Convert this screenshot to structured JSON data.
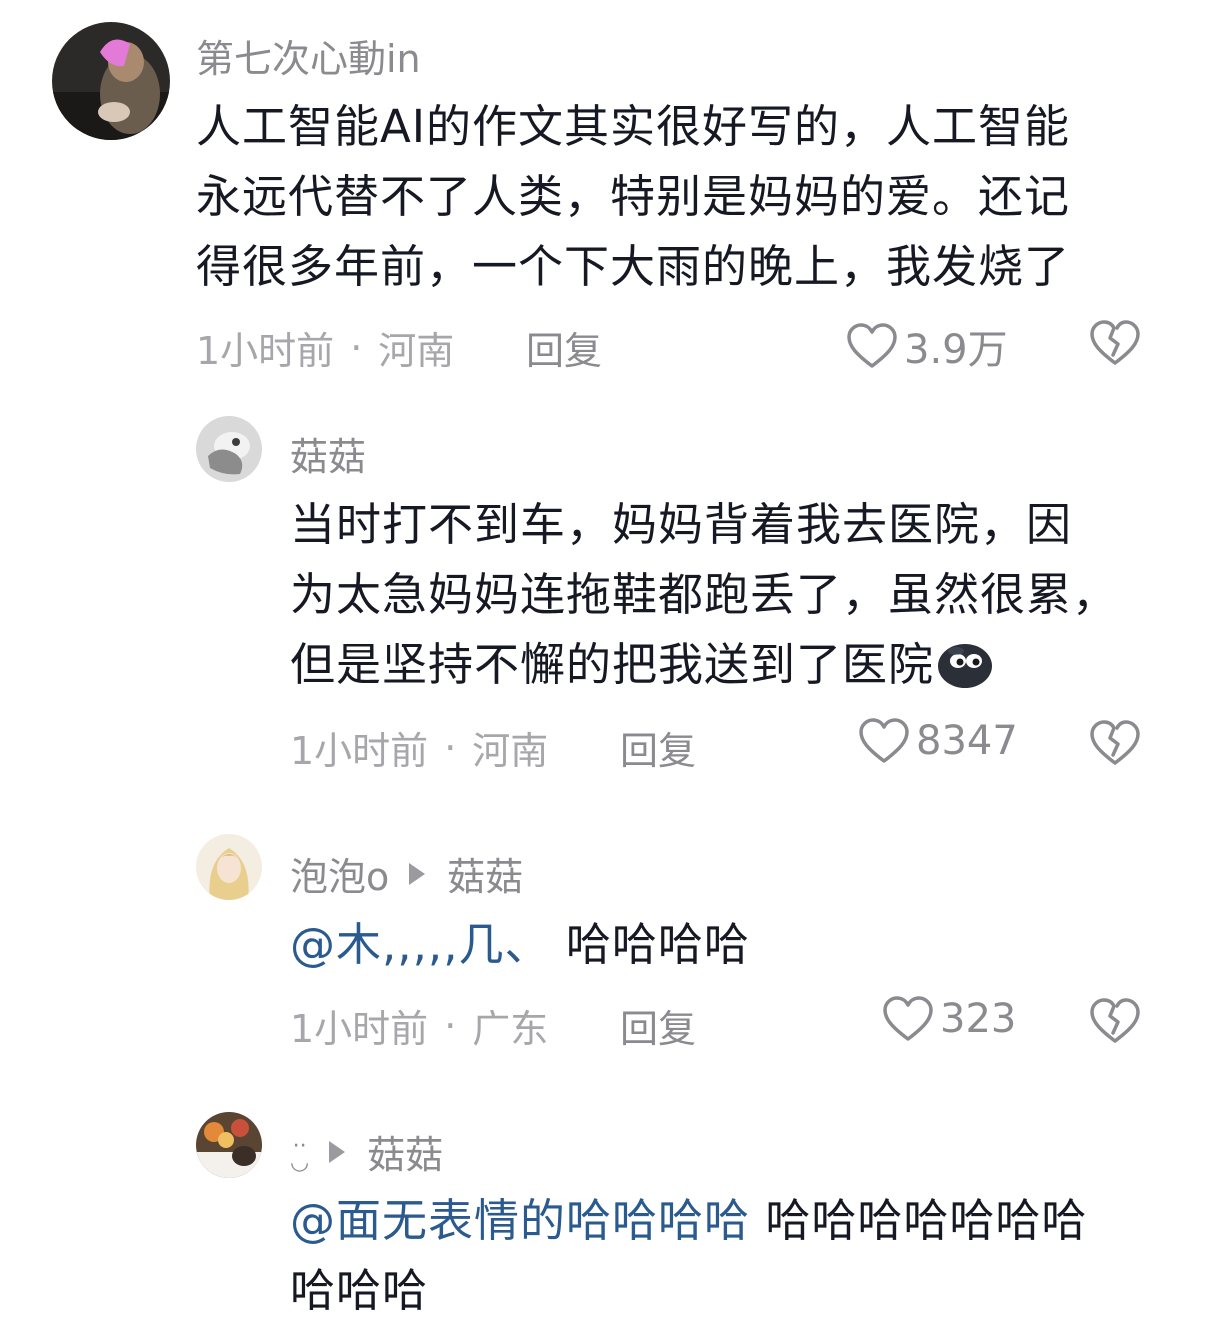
{
  "comments": [
    {
      "username": "第七次心動in",
      "text_lines": [
        "人工智能AI的作文其实很好写的，人工智能",
        "永远代替不了人类，特别是妈妈的爱。还记",
        "得很多年前，一个下大雨的晚上，我发烧了"
      ],
      "time": "1小时前",
      "location": "河南",
      "reply_label": "回复",
      "likes": "3.9万",
      "avatar_icon": "avatar-photo"
    },
    {
      "username": "菇菇",
      "text_lines": [
        "当时打不到车，妈妈背着我去医院，因",
        "为太急妈妈连拖鞋都跑丢了，虽然很累，",
        "但是坚持不懈的把我送到了医院"
      ],
      "time": "1小时前",
      "location": "河南",
      "reply_label": "回复",
      "likes": "8347",
      "avatar_icon": "avatar-photo"
    },
    {
      "username": "泡泡o",
      "reply_to": "菇菇",
      "mention": "@木,,,,,几、",
      "text": "哈哈哈哈",
      "time": "1小时前",
      "location": "广东",
      "reply_label": "回复",
      "likes": "323",
      "avatar_icon": "avatar-photo"
    },
    {
      "username": "··",
      "reply_to": "菇菇",
      "mention": "@面无表情的哈哈哈哈",
      "text": "哈哈哈哈哈哈哈",
      "text_line2": "哈哈哈",
      "avatar_icon": "avatar-photo"
    }
  ],
  "separator": "·",
  "colors": {
    "text": "#161823",
    "meta": "#a7a7ab",
    "mention": "#2a5a8e"
  }
}
